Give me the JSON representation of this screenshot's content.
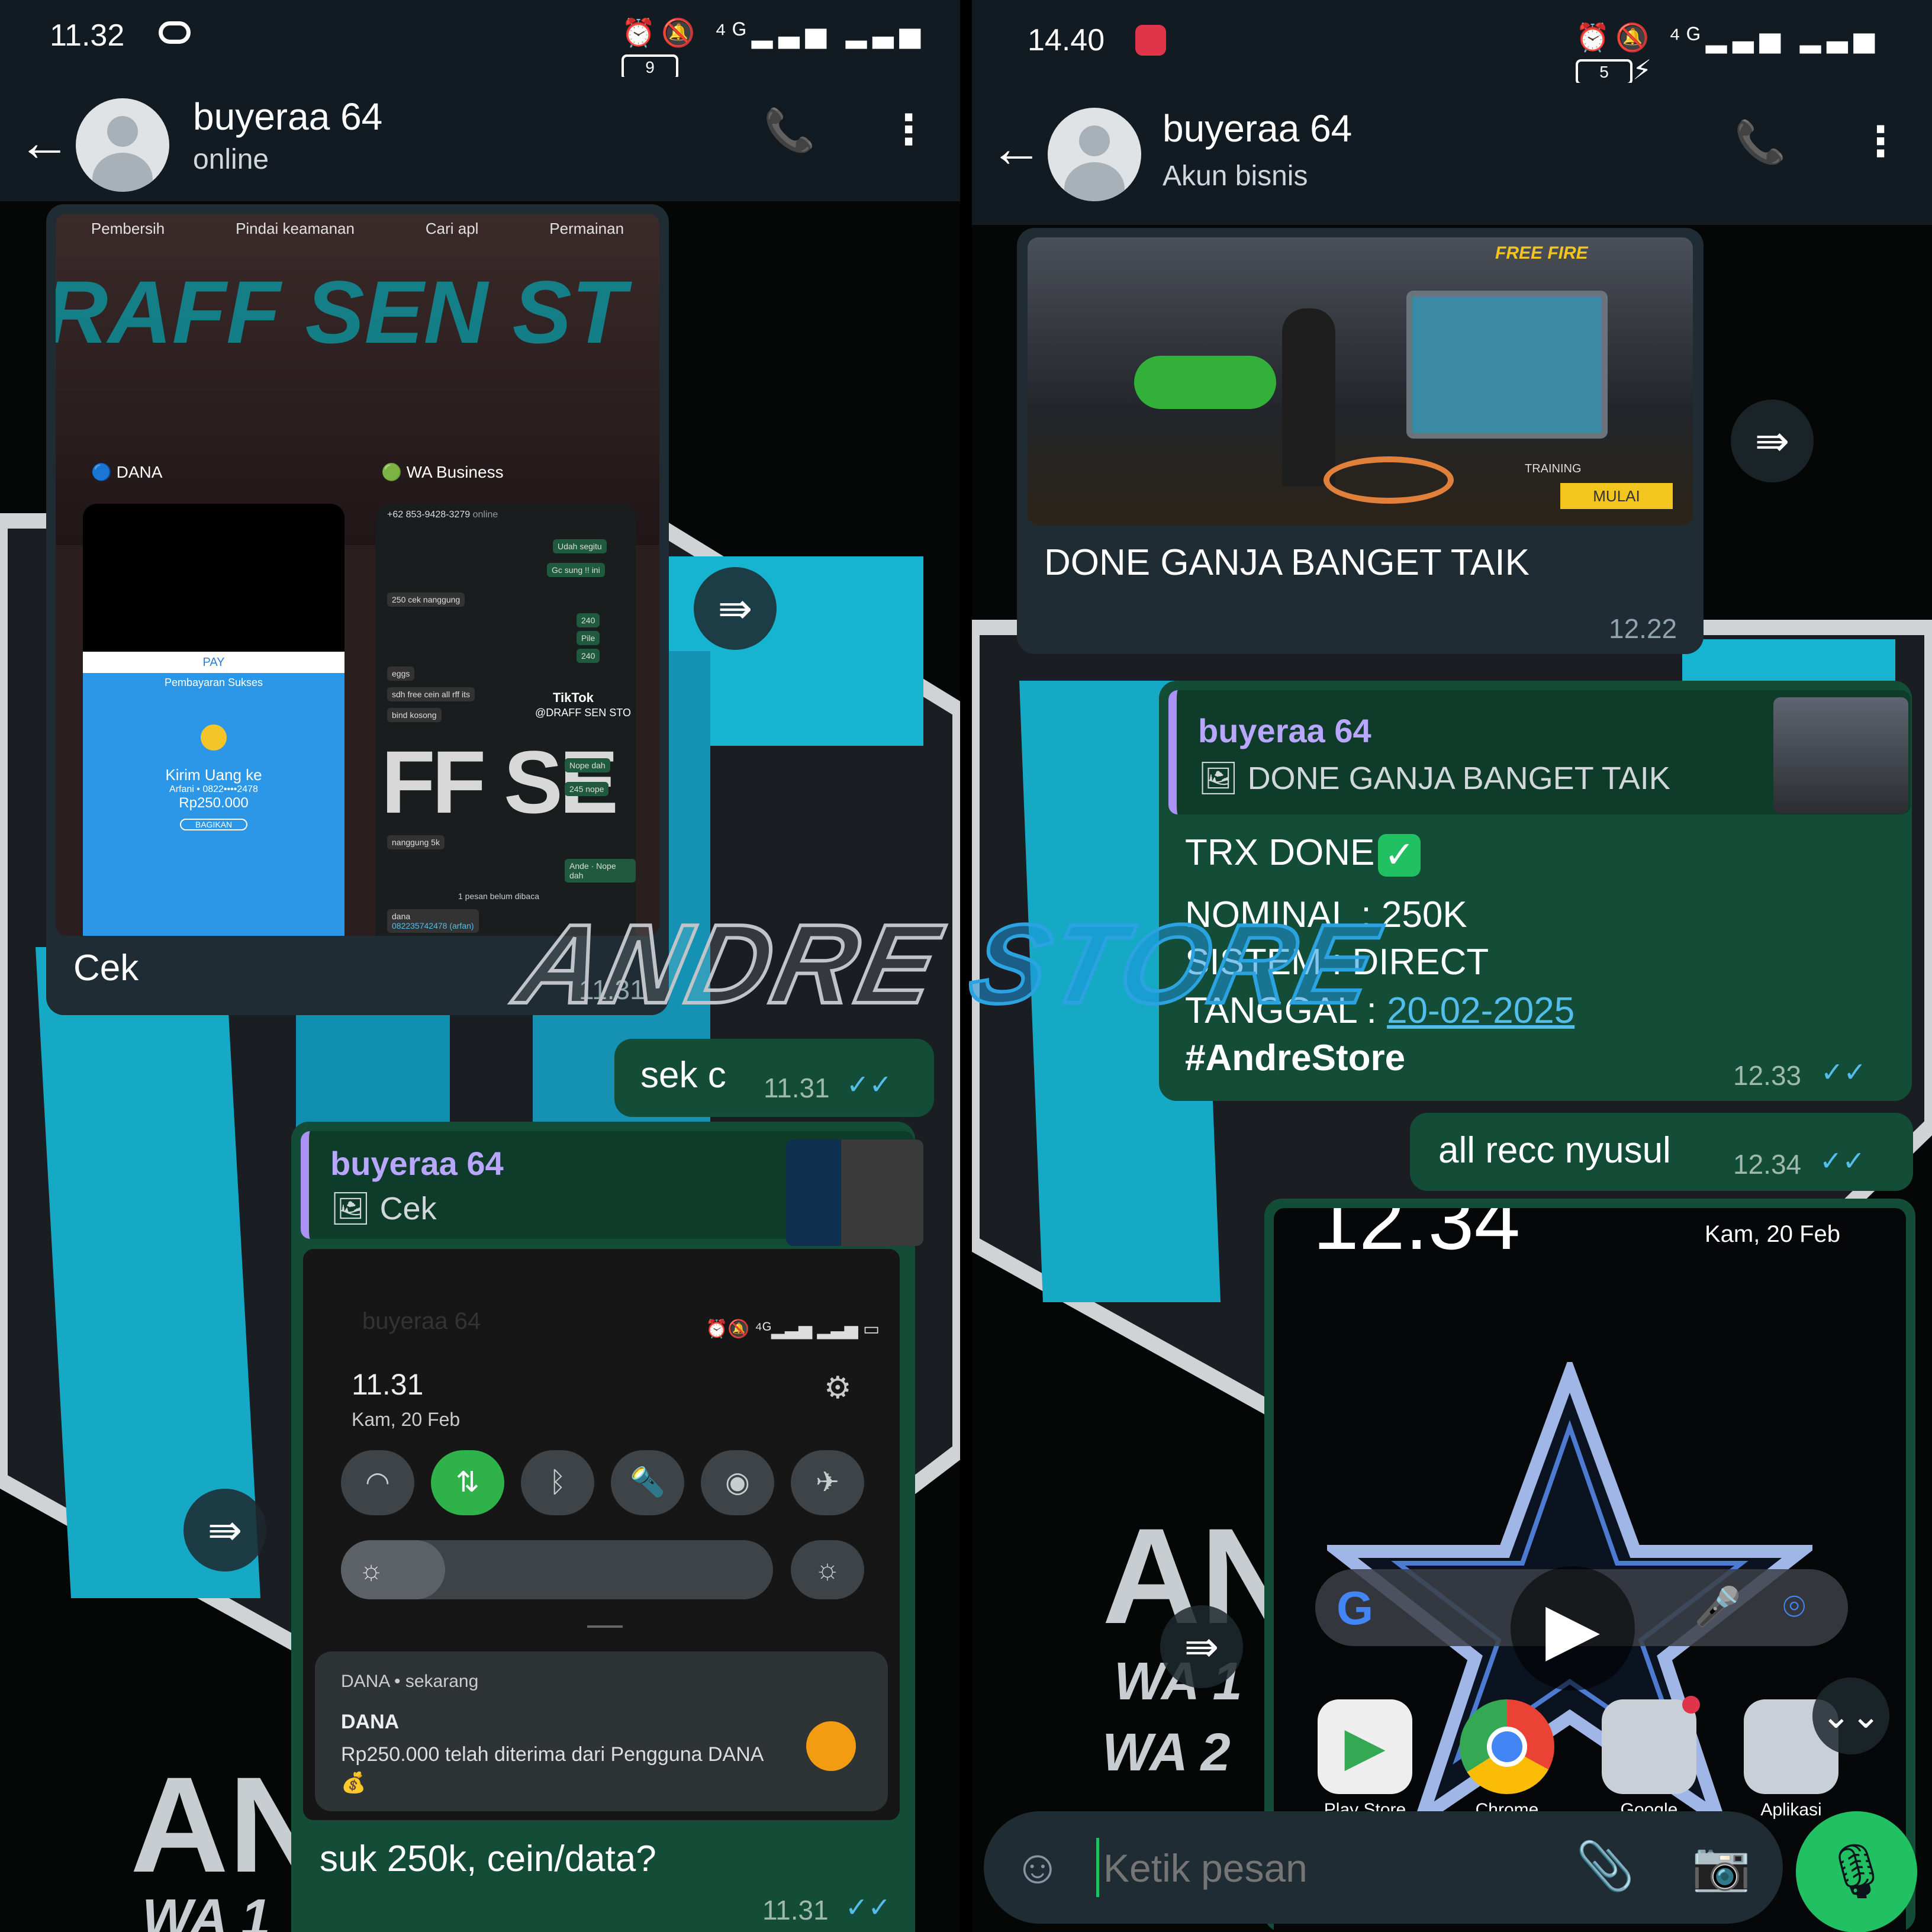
{
  "left": {
    "status": {
      "time": "11.32",
      "battery": "9"
    },
    "header": {
      "name": "buyeraa 64",
      "status": "online"
    },
    "image_msg": {
      "shortcuts": [
        "Pembersih",
        "Pindai keamanan",
        "Cari apl",
        "Permainan"
      ],
      "apps": [
        "DANA",
        "WA Business"
      ],
      "art_text": "RAFF SEN ST",
      "dana_screen": {
        "brand": "PAY",
        "title": "Pembayaran Sukses",
        "line1": "Kirim Uang ke",
        "line2": "Arfani • 0822••••2478",
        "amount": "Rp250.000",
        "button": "BAGIKAN"
      },
      "wa_screen": {
        "contact": "+62 853-9428-3279",
        "sub": "online",
        "msgs": [
          "Udah segitu",
          "Gc sung !! ini",
          "250 cek nanggung",
          "240",
          "Pile",
          "240",
          "eggs",
          "sdh free cein all rff its",
          "bind kosong",
          "TikTok",
          "@DRAFF SEN STO",
          "Nope dah",
          "245 nope",
          "nanggung 5k",
          "Ande",
          "Nope dah",
          "1 pesan belum dibaca",
          "dana",
          "082235742478 (arfan)"
        ]
      },
      "caption": "Cek",
      "time": "11.31"
    },
    "msg_sek": {
      "text": "sek c",
      "time": "11.31"
    },
    "reply_msg": {
      "quote_name": "buyeraa 64",
      "quote_text": "Cek",
      "notif_screen": {
        "time": "11.31",
        "date": "Kam, 20 Feb",
        "header_name": "buyeraa 64"
      },
      "notification": {
        "app": "DANA • sekarang",
        "title": "DANA",
        "body": "Rp250.000 telah diterima dari Pengguna DANA 💰"
      },
      "text": "suk 250k, cein/data?",
      "time": "11.31"
    },
    "wall_text": [
      "AN",
      "WA 1"
    ]
  },
  "right": {
    "status": {
      "time": "14.40",
      "battery": "5"
    },
    "header": {
      "name": "buyeraa 64",
      "status": "Akun bisnis"
    },
    "game_msg": {
      "game_logo": "FREE FIRE",
      "hud_button": "MULAI",
      "hud_label": "TRAINING",
      "caption": "DONE GANJA BANGET TAIK",
      "time": "12.22"
    },
    "trx_msg": {
      "quote_name": "buyeraa 64",
      "quote_text": "DONE GANJA BANGET TAIK",
      "line1": "TRX DONE",
      "line2": "NOMINAL : 250K",
      "line3": "SISTEM : DIRECT",
      "line4_label": "TANGGAL : ",
      "line4_date": "20-02-2025",
      "line5": "#AndreStore",
      "time": "12.33"
    },
    "msg_recc": {
      "text": "all recc nyusul",
      "time": "12.34"
    },
    "home_screen": {
      "clock": "12.34",
      "date": "Kam, 20 Feb",
      "apps": [
        "Play Store",
        "Chrome",
        "Google",
        "Aplikasi"
      ]
    },
    "input": {
      "placeholder": "Ketik pesan"
    },
    "wall_text": [
      "ANI",
      "WA 1",
      "WA 2"
    ]
  },
  "watermark": {
    "part1": "ANDRE",
    "part2": "STORE"
  },
  "colors": {
    "outgoing": "#005c4b",
    "incoming": "#1f2c34",
    "accent": "#21c063",
    "link": "#53bdeb",
    "quote_bar": "#a992f4"
  }
}
